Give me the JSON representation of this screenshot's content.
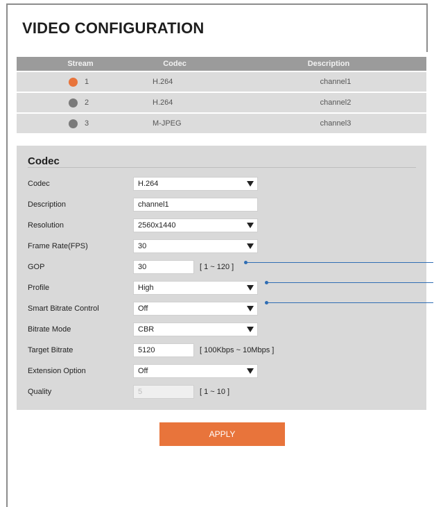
{
  "page": {
    "title": "VIDEO CONFIGURATION"
  },
  "stream_table": {
    "headers": {
      "stream": "Stream",
      "codec": "Codec",
      "description": "Description"
    },
    "rows": [
      {
        "stream": "1",
        "codec": "H.264",
        "description": "channel1",
        "selected": true
      },
      {
        "stream": "2",
        "codec": "H.264",
        "description": "channel2",
        "selected": false
      },
      {
        "stream": "3",
        "codec": "M-JPEG",
        "description": "channel3",
        "selected": false
      }
    ]
  },
  "codec_section": {
    "title": "Codec",
    "fields": {
      "codec": {
        "label": "Codec",
        "value": "H.264"
      },
      "description": {
        "label": "Description",
        "value": "channel1"
      },
      "resolution": {
        "label": "Resolution",
        "value": "2560x1440"
      },
      "frame_rate": {
        "label": "Frame Rate(FPS)",
        "value": "30"
      },
      "gop": {
        "label": "GOP",
        "value": "30",
        "range": "[ 1 ~ 120 ]"
      },
      "profile": {
        "label": "Profile",
        "value": "High"
      },
      "smart_bitrate": {
        "label": "Smart Bitrate Control",
        "value": "Off"
      },
      "bitrate_mode": {
        "label": "Bitrate Mode",
        "value": "CBR"
      },
      "target_bitrate": {
        "label": "Target Bitrate",
        "value": "5120",
        "range": "[ 100Kbps ~ 10Mbps ]"
      },
      "extension_option": {
        "label": "Extension Option",
        "value": "Off"
      },
      "quality": {
        "label": "Quality",
        "value": "5",
        "range": "[ 1 ~ 10 ]"
      }
    }
  },
  "actions": {
    "apply_label": "APPLY"
  },
  "colors": {
    "accent": "#e8743b",
    "header_gray": "#9b9b9b",
    "panel_gray": "#d9d9d9",
    "pointer_blue": "#2f6db3"
  }
}
